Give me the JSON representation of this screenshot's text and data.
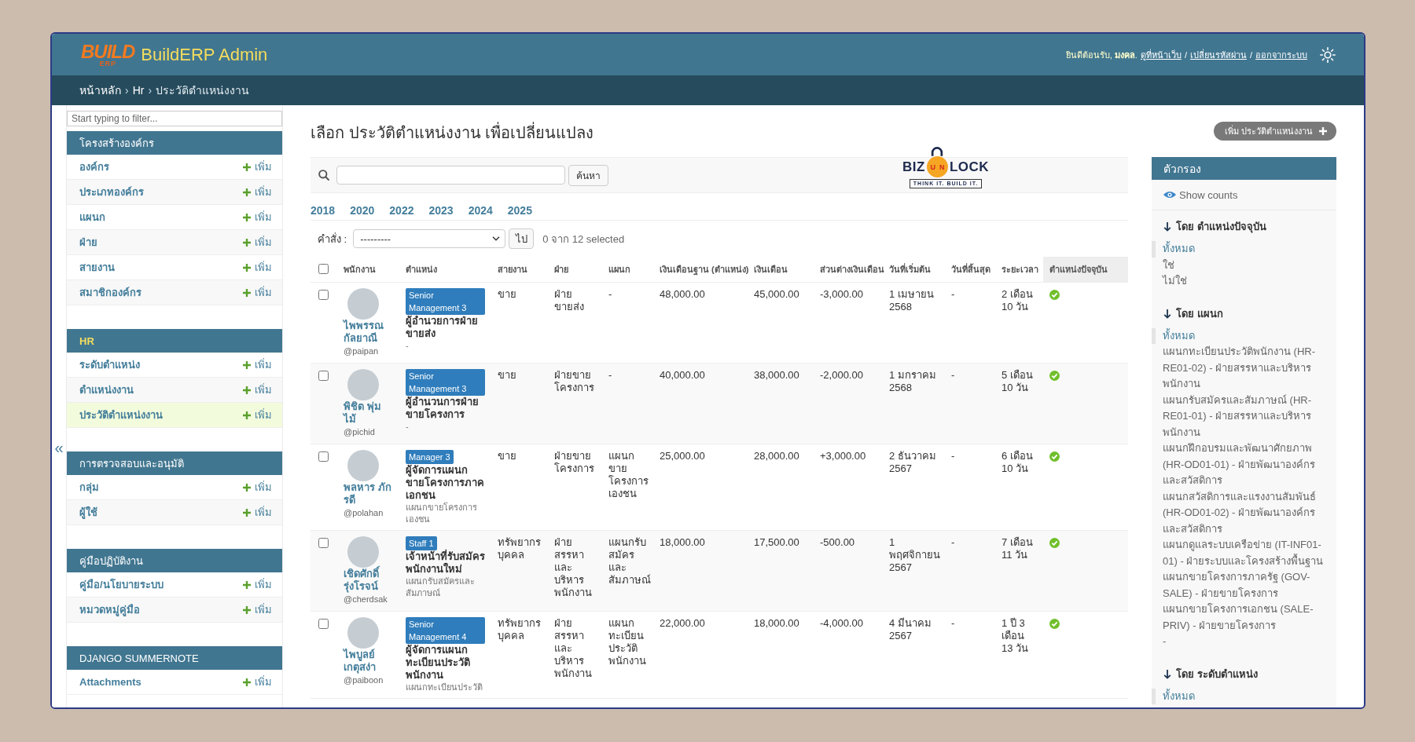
{
  "header": {
    "logo": {
      "word": "BUILD",
      "sub": "ERP"
    },
    "title": "BuildERP Admin",
    "welcome": "ยินดีต้อนรับ, **มงคล**.",
    "links": [
      "ดูที่หน้าเว็บ",
      "เปลี่ยนรหัสผ่าน",
      "ออกจากระบบ"
    ],
    "link_separator": "/"
  },
  "breadcrumbs": {
    "separator": "›",
    "items": [
      {
        "label": "หน้าหลัก",
        "kind": "link"
      },
      {
        "label": "Hr",
        "kind": "link"
      },
      {
        "label": "ประวัติตำแหน่งงาน",
        "kind": "current"
      }
    ]
  },
  "sidebar": {
    "toggle": "«",
    "filter_placeholder": "Start typing to filter...",
    "sections": [
      {
        "title": "โครงสร้างองค์กร",
        "current": false,
        "items": [
          {
            "label": "องค์กร",
            "add": "เพิ่ม",
            "selected": false
          },
          {
            "label": "ประเภทองค์กร",
            "add": "เพิ่ม",
            "selected": false
          },
          {
            "label": "แผนก",
            "add": "เพิ่ม",
            "selected": false
          },
          {
            "label": "ฝ่าย",
            "add": "เพิ่ม",
            "selected": false
          },
          {
            "label": "สายงาน",
            "add": "เพิ่ม",
            "selected": false
          },
          {
            "label": "สมาชิกองค์กร",
            "add": "เพิ่ม",
            "selected": false
          }
        ]
      },
      {
        "title": "HR",
        "current": true,
        "items": [
          {
            "label": "ระดับตำแหน่ง",
            "add": "เพิ่ม",
            "selected": false
          },
          {
            "label": "ตำแหน่งงาน",
            "add": "เพิ่ม",
            "selected": false
          },
          {
            "label": "ประวัติตำแหน่งงาน",
            "add": "เพิ่ม",
            "selected": true
          }
        ]
      },
      {
        "title": "การตรวจสอบและอนุมัติ",
        "current": false,
        "items": [
          {
            "label": "กลุ่ม",
            "add": "เพิ่ม",
            "selected": false
          },
          {
            "label": "ผู้ใช้",
            "add": "เพิ่ม",
            "selected": false
          }
        ]
      },
      {
        "title": "คู่มือปฏิบัติงาน",
        "current": false,
        "items": [
          {
            "label": "คู่มือ/นโยบายระบบ",
            "add": "เพิ่ม",
            "selected": false
          },
          {
            "label": "หมวดหมู่คู่มือ",
            "add": "เพิ่ม",
            "selected": false
          }
        ]
      },
      {
        "title": "DJANGO SUMMERNOTE",
        "current": false,
        "items": [
          {
            "label": "Attachments",
            "add": "เพิ่ม",
            "selected": false
          }
        ]
      }
    ]
  },
  "content": {
    "title": "เลือก ประวัติตำแหน่งงาน เพื่อเปลี่ยนแปลง",
    "add_button": "เพิ่ม ประวัติตำแหน่งงาน"
  },
  "search": {
    "button": "ค้นหา"
  },
  "brand_logo": {
    "left": "BIZ",
    "lock": "UN",
    "right": "LOCK",
    "tagline": "THINK IT. BUILD IT."
  },
  "years": [
    "2018",
    "2020",
    "2022",
    "2023",
    "2024",
    "2025"
  ],
  "actions": {
    "label": "คำสั่ง :",
    "select_value": "---------",
    "go": "ไป",
    "counter": "0 จาก 12 selected"
  },
  "table": {
    "select_all_checked": false,
    "columns": [
      {
        "label": "พนักงาน",
        "sorted": false
      },
      {
        "label": "ตำแหน่ง",
        "sorted": false
      },
      {
        "label": "สายงาน",
        "sorted": false
      },
      {
        "label": "ฝ่าย",
        "sorted": false
      },
      {
        "label": "แผนก",
        "sorted": false
      },
      {
        "label": "เงินเดือนฐาน (ตำแหน่ง)",
        "sorted": false
      },
      {
        "label": "เงินเดือน",
        "sorted": false
      },
      {
        "label": "ส่วนต่างเงินเดือน",
        "sorted": false
      },
      {
        "label": "วันที่เริ่มต้น",
        "sorted": false
      },
      {
        "label": "วันที่สิ้นสุด",
        "sorted": false
      },
      {
        "label": "ระยะเวลา",
        "sorted": false
      },
      {
        "label": "ตำแหน่งปัจจุบัน",
        "sorted": true
      }
    ],
    "rows": [
      {
        "checked": false,
        "name": "ไพพรรณ กัลยาณี",
        "username": "@paipan",
        "badge": "Senior Management 3",
        "position": "ผู้อำนวยการฝ่ายขายส่ง",
        "position_note": "-",
        "line": "ขาย",
        "division": "ฝ่ายขายส่ง",
        "department": "-",
        "base_salary": "48,000.00",
        "salary": "45,000.00",
        "difference": "-3,000.00",
        "start_date": "1 เมษายน 2568",
        "end_date": "-",
        "duration": "2 เดือน 10 วัน",
        "current": true
      },
      {
        "checked": false,
        "name": "พิชิต พุ่มไม้",
        "username": "@pichid",
        "badge": "Senior Management 3",
        "position": "ผู้อำนวนการฝ่ายขายโครงการ",
        "position_note": "-",
        "line": "ขาย",
        "division": "ฝ่ายขายโครงการ",
        "department": "-",
        "base_salary": "40,000.00",
        "salary": "38,000.00",
        "difference": "-2,000.00",
        "start_date": "1 มกราคม 2568",
        "end_date": "-",
        "duration": "5 เดือน 10 วัน",
        "current": true
      },
      {
        "checked": false,
        "name": "พลหาร ภักรดี",
        "username": "@polahan",
        "badge": "Manager 3",
        "position": "ผู้จัดการแผนกขายโครงการภาคเอกชน",
        "position_note": "แผนกขายโครงการเองชน",
        "line": "ขาย",
        "division": "ฝ่ายขายโครงการ",
        "department": "แผนกขายโครงการเองชน",
        "base_salary": "25,000.00",
        "salary": "28,000.00",
        "difference": "+3,000.00",
        "start_date": "2 ธันวาคม 2567",
        "end_date": "-",
        "duration": "6 เดือน 10 วัน",
        "current": true
      },
      {
        "checked": false,
        "name": "เชิดศักดิ์ รุ่งโรจน์",
        "username": "@cherdsak",
        "badge": "Staff 1",
        "position": "เจ้าหน้าที่รับสมัครพนักงานใหม่",
        "position_note": "แผนกรับสมัครและสัมภาษณ์",
        "line": "ทรัพยากรบุคคล",
        "division": "ฝ่ายสรรหาและบริหารพนักงาน",
        "department": "แผนกรับสมัครและสัมภาษณ์",
        "base_salary": "18,000.00",
        "salary": "17,500.00",
        "difference": "-500.00",
        "start_date": "1 พฤศจิกายน 2567",
        "end_date": "-",
        "duration": "7 เดือน 11 วัน",
        "current": true
      },
      {
        "checked": false,
        "name": "ไพบูลย์ เกตุสง่า",
        "username": "@paiboon",
        "badge": "Senior Management 4",
        "position": "ผู้จัดการแผนกทะเบียนประวัติพนักงาน",
        "position_note": "แผนกทะเบียนประวัติ",
        "line": "ทรัพยากรบุคคล",
        "division": "ฝ่ายสรรหาและบริหารพนักงาน",
        "department": "แผนกทะเบียนประวัติพนักงาน",
        "base_salary": "22,000.00",
        "salary": "18,000.00",
        "difference": "-4,000.00",
        "start_date": "4 มีนาคม 2567",
        "end_date": "-",
        "duration": "1 ปี 3 เดือน 13 วัน",
        "current": true
      }
    ]
  },
  "filter": {
    "title": "ตัวกรอง",
    "show_counts": "Show counts",
    "groups": [
      {
        "title": "โดย ตำแหน่งปัจจุบัน",
        "choices": [
          {
            "label": "ทั้งหมด",
            "selected": true
          },
          {
            "label": "ใช่",
            "selected": false
          },
          {
            "label": "ไม่ใช่",
            "selected": false
          }
        ]
      },
      {
        "title": "โดย แผนก",
        "choices": [
          {
            "label": "ทั้งหมด",
            "selected": true
          },
          {
            "label": "แผนกทะเบียนประวัติพนักงาน (HR-RE01-02) - ฝ่ายสรรหาและบริหารพนักงาน",
            "selected": false
          },
          {
            "label": "แผนกรับสมัครและสัมภาษณ์ (HR-RE01-01) - ฝ่ายสรรหาและบริหารพนักงาน",
            "selected": false
          },
          {
            "label": "แผนกฝึกอบรมและพัฒนาศักยภาพ (HR-OD01-01) - ฝ่ายพัฒนาองค์กรและสวัสดิการ",
            "selected": false
          },
          {
            "label": "แผนกสวัสดิการและแรงงานสัมพันธ์ (HR-OD01-02) - ฝ่ายพัฒนาองค์กรและสวัสดิการ",
            "selected": false
          },
          {
            "label": "แผนกดูแลระบบเครือข่าย (IT-INF01-01) - ฝ่ายระบบและโครงสร้างพื้นฐาน",
            "selected": false
          },
          {
            "label": "แผนกขายโครงการภาครัฐ (GOV-SALE) - ฝ่ายขายโครงการ",
            "selected": false
          },
          {
            "label": "แผนกขายโครงการเอกชน (SALE-PRIV) - ฝ่ายขายโครงการ",
            "selected": false
          },
          {
            "label": "-",
            "selected": false
          }
        ]
      },
      {
        "title": "โดย ระดับตำแหน่ง",
        "choices": [
          {
            "label": "ทั้งหมด",
            "selected": true
          }
        ]
      }
    ]
  }
}
